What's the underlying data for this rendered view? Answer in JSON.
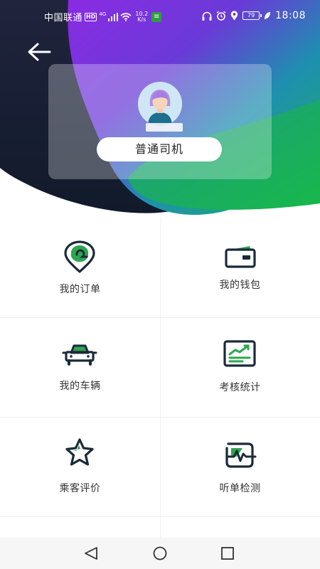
{
  "status_bar": {
    "carrier": "中国联通",
    "hd": "HD",
    "network": "4G",
    "speed_value": "10.2",
    "speed_unit": "K/s",
    "battery": "79",
    "time": "18:08"
  },
  "header": {
    "back_icon": "arrow-left-icon"
  },
  "profile": {
    "avatar_icon": "avatar-girl-icon",
    "name": "",
    "role": "普通司机"
  },
  "menu": {
    "items": [
      {
        "icon": "order-pin-icon",
        "label": "我的订单"
      },
      {
        "icon": "wallet-icon",
        "label": "我的钱包"
      },
      {
        "icon": "car-icon",
        "label": "我的车辆"
      },
      {
        "icon": "chart-board-icon",
        "label": "考核统计"
      },
      {
        "icon": "star-icon",
        "label": "乘客评价"
      },
      {
        "icon": "pulse-monitor-icon",
        "label": "听单检测"
      }
    ]
  },
  "navigation": {
    "back": "nav-back-icon",
    "home": "nav-home-icon",
    "recents": "nav-recents-icon"
  },
  "colors": {
    "navy": "#1c2540",
    "purple": "#7b2fe0",
    "green": "#1fb35a",
    "teal": "#19a38f",
    "icon_dark": "#1b2a3a",
    "icon_green": "#2ea64f"
  }
}
